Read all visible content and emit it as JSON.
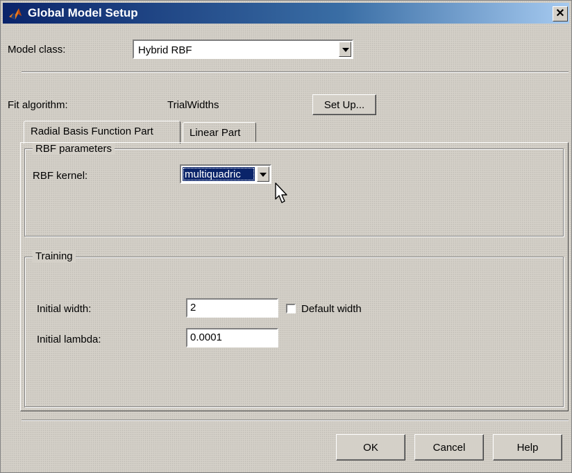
{
  "window": {
    "title": "Global Model Setup",
    "close_glyph": "✕",
    "app_icon": "matlab-icon"
  },
  "model_class": {
    "label": "Model class:",
    "value": "Hybrid RBF"
  },
  "fit_algorithm": {
    "label": "Fit algorithm:",
    "value": "TrialWidths",
    "setup_label": "Set Up..."
  },
  "tabs": [
    {
      "label": "Radial Basis Function Part",
      "active": true
    },
    {
      "label": "Linear Part",
      "active": false
    }
  ],
  "rbf_parameters": {
    "title": "RBF parameters",
    "kernel_label": "RBF kernel:",
    "kernel_value": "multiquadric"
  },
  "training": {
    "title": "Training",
    "initial_width_label": "Initial width:",
    "initial_width_value": "2",
    "default_width_label": "Default width",
    "default_width_checked": false,
    "initial_lambda_label": "Initial lambda:",
    "initial_lambda_value": "0.0001"
  },
  "buttons": {
    "ok": "OK",
    "cancel": "Cancel",
    "help": "Help"
  },
  "colors": {
    "titlebar": "#0a246a",
    "face": "#d4d0c8",
    "selection": "#0a246a"
  }
}
